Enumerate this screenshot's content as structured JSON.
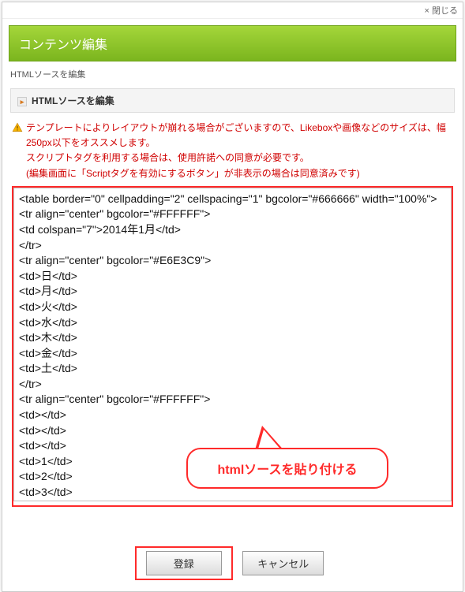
{
  "close_label": "× 閉じる",
  "title": "コンテンツ編集",
  "breadcrumb": "HTMLソースを編集",
  "section_header": "HTMLソースを編集",
  "warning": {
    "line1": "テンプレートによりレイアウトが崩れる場合がございますので、Likeboxや画像などのサイズは、幅250px以下をオススメします。",
    "line2": "スクリプトタグを利用する場合は、使用許諾への同意が必要です。",
    "line3": "(編集画面に「Scriptタグを有効にするボタン」が非表示の場合は同意済みです)"
  },
  "code_value": "<table border=\"0\" cellpadding=\"2\" cellspacing=\"1\" bgcolor=\"#666666\" width=\"100%\">\n<tr align=\"center\" bgcolor=\"#FFFFFF\">\n<td colspan=\"7\">2014年1月</td>\n</tr>\n<tr align=\"center\" bgcolor=\"#E6E3C9\">\n<td>日</td>\n<td>月</td>\n<td>火</td>\n<td>水</td>\n<td>木</td>\n<td>金</td>\n<td>土</td>\n</tr>\n<tr align=\"center\" bgcolor=\"#FFFFFF\">\n<td></td>\n<td></td>\n<td></td>\n<td>1</td>\n<td>2</td>\n<td>3</td>",
  "callout_text": "htmlソースを貼り付ける",
  "buttons": {
    "submit": "登録",
    "cancel": "キャンセル"
  }
}
